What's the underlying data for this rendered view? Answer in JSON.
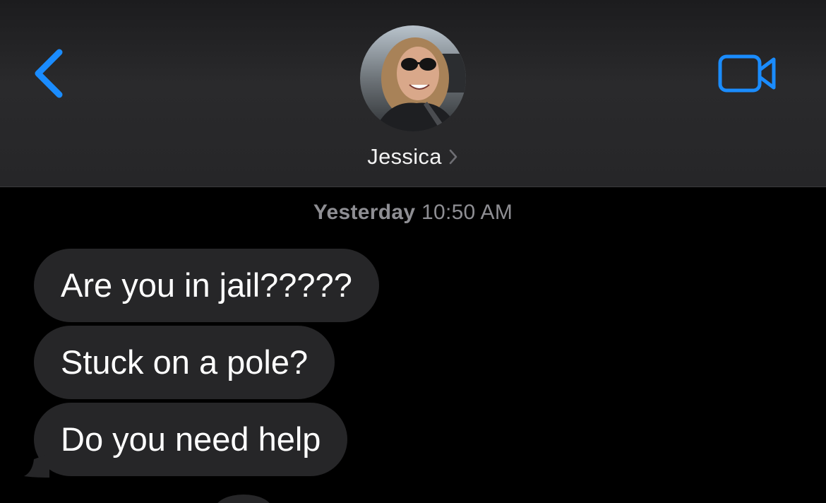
{
  "header": {
    "contact_name": "Jessica",
    "accent_color": "#1a8cff",
    "icons": {
      "back": "chevron-left-icon",
      "video": "video-camera-icon",
      "name_chevron": "chevron-right-icon"
    }
  },
  "thread": {
    "timestamp_day": "Yesterday",
    "timestamp_time": "10:50 AM",
    "messages": [
      {
        "text": "Are you in jail?????",
        "direction": "incoming"
      },
      {
        "text": "Stuck on a pole?",
        "direction": "incoming"
      },
      {
        "text": "Do you need help",
        "direction": "incoming"
      }
    ]
  },
  "colors": {
    "background": "#000000",
    "bubble_incoming": "#262628",
    "timestamp": "#8e8e93"
  }
}
